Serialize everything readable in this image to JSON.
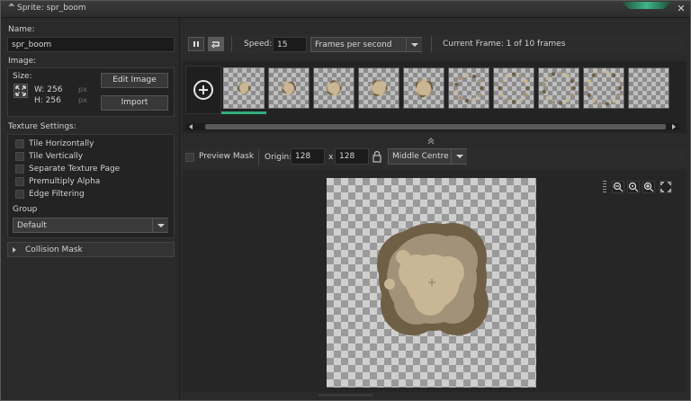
{
  "window": {
    "title": "Sprite: spr_boom",
    "close_glyph": "✕"
  },
  "left": {
    "name_label": "Name:",
    "name_value": "spr_boom",
    "image_label": "Image:",
    "size_label": "Size:",
    "width_label": "W: 256",
    "height_label": "H: 256",
    "px_unit": "px",
    "edit_image": "Edit Image",
    "import": "Import",
    "texture_settings": "Texture Settings:",
    "options": [
      "Tile Horizontally",
      "Tile Vertically",
      "Separate Texture Page",
      "Premultiply Alpha",
      "Edge Filtering"
    ],
    "group_label": "Group",
    "group_value": "Default",
    "collision_mask": "Collision Mask"
  },
  "toolbar": {
    "speed_label": "Speed:",
    "speed_value": "15",
    "speed_unit": "Frames per second",
    "current_frame": "Current Frame: 1 of 10 frames"
  },
  "frames": {
    "count_visible": 10,
    "selected_index": 0,
    "selected_color": "#2fae7d"
  },
  "maskbar": {
    "preview_mask": "Preview Mask",
    "origin_label": "Origin:",
    "origin_x": "128",
    "origin_sep": "x",
    "origin_y": "128",
    "origin_preset": "Middle Centre"
  },
  "colors": {
    "accent": "#3fb489",
    "smoke_dark": "#6f5f45",
    "smoke_mid": "#a3927a",
    "smoke_light": "#c8b694"
  }
}
